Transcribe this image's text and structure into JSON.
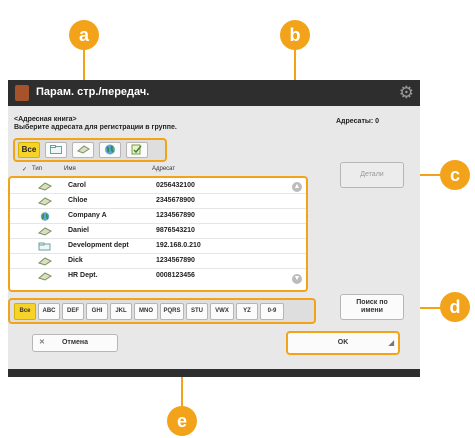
{
  "callouts": [
    "a",
    "b",
    "c",
    "d",
    "e"
  ],
  "colors": {
    "accent": "#f3a31a",
    "selected": "#f7d32a",
    "titlebar": "#2e2e2e"
  },
  "title": "Парам. стр./передач.",
  "heading_line1": "<Адресная книга>",
  "heading_line2": "Выберите адресата для регистрации в группе.",
  "address_count": "Адресаты: 0",
  "filter_buttons": [
    {
      "label": "Все",
      "icon": null,
      "selected": true
    },
    {
      "label": "",
      "icon": "folder-icon",
      "selected": false
    },
    {
      "label": "",
      "icon": "fax-icon",
      "selected": false
    },
    {
      "label": "",
      "icon": "globe-icon",
      "selected": false
    },
    {
      "label": "",
      "icon": "group-icon",
      "selected": false
    }
  ],
  "columns": {
    "type": "Тип",
    "name": "Имя",
    "address": "Адресат"
  },
  "rows": [
    {
      "name": "Carol",
      "address": "0256432100",
      "icon": "fax-icon"
    },
    {
      "name": "Chloe",
      "address": "2345678900",
      "icon": "fax-icon"
    },
    {
      "name": "Company A",
      "address": "1234567890",
      "icon": "globe-icon"
    },
    {
      "name": "Daniel",
      "address": "9876543210",
      "icon": "fax-icon"
    },
    {
      "name": "Development dept",
      "address": "192.168.0.210",
      "icon": "folder-icon"
    },
    {
      "name": "Dick",
      "address": "1234567890",
      "icon": "fax-icon"
    },
    {
      "name": "HR Dept.",
      "address": "0008123456",
      "icon": "fax-icon"
    }
  ],
  "details_button": "Детали",
  "search_button": "Поиск по имени",
  "alpha_buttons": [
    "Все",
    "ABC",
    "DEF",
    "GHI",
    "JKL",
    "MNO",
    "PQRS",
    "STU",
    "VWX",
    "YZ",
    "0-9"
  ],
  "cancel_button": "Отмена",
  "ok_button": "OK"
}
